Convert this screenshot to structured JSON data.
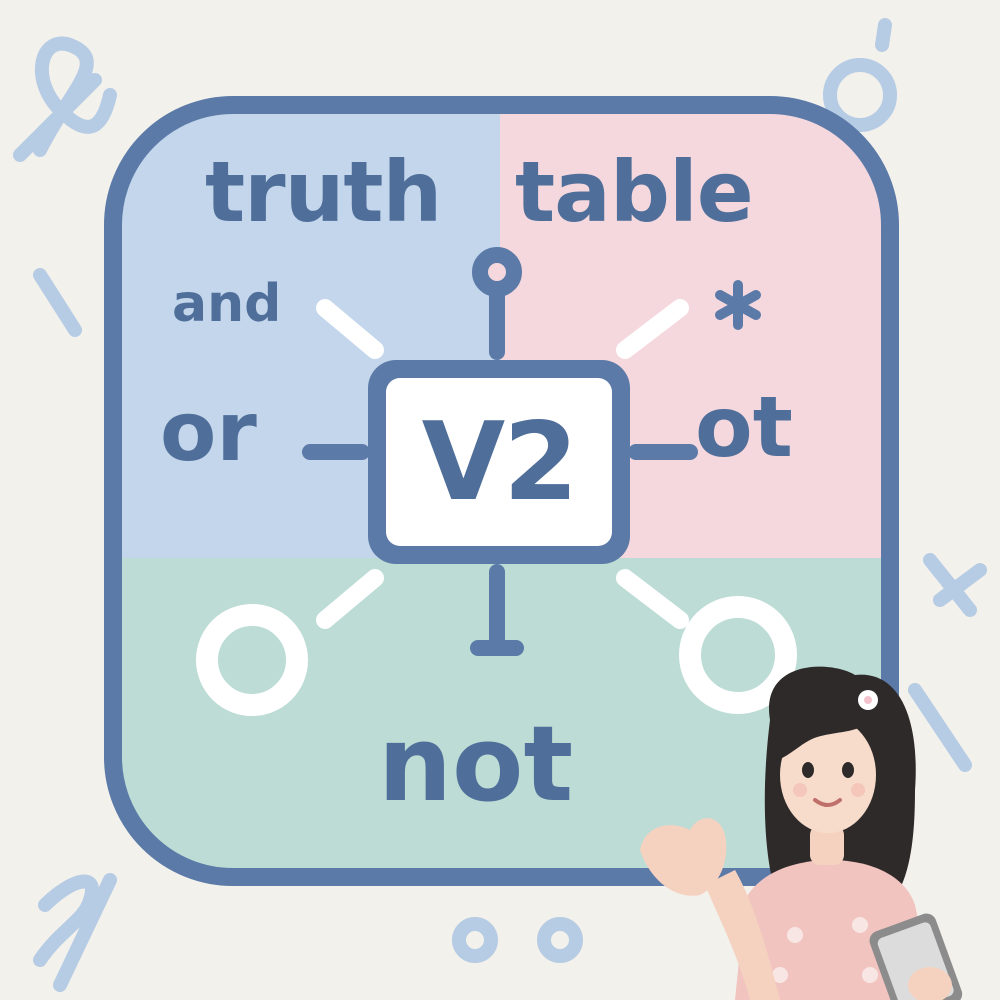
{
  "title": {
    "word1": "truth",
    "word2": "table"
  },
  "center_label": "V2",
  "labels": {
    "and": "and",
    "or": "or",
    "ot": "ot",
    "not": "not"
  },
  "colors": {
    "background": "#f2f1ec",
    "frame": "#5b7aa8",
    "text": "#4f6f9a",
    "quadrant_blue": "#c3d6ec",
    "quadrant_pink": "#f5d8dd",
    "quadrant_green": "#bcdcd5",
    "node_white": "#ffffff",
    "doodles": "#b6cbe4"
  },
  "icons": [
    "ribbon-doodle",
    "ring-doodle",
    "asterisk-doodle",
    "circle-node",
    "waving-girl-with-tablet"
  ]
}
